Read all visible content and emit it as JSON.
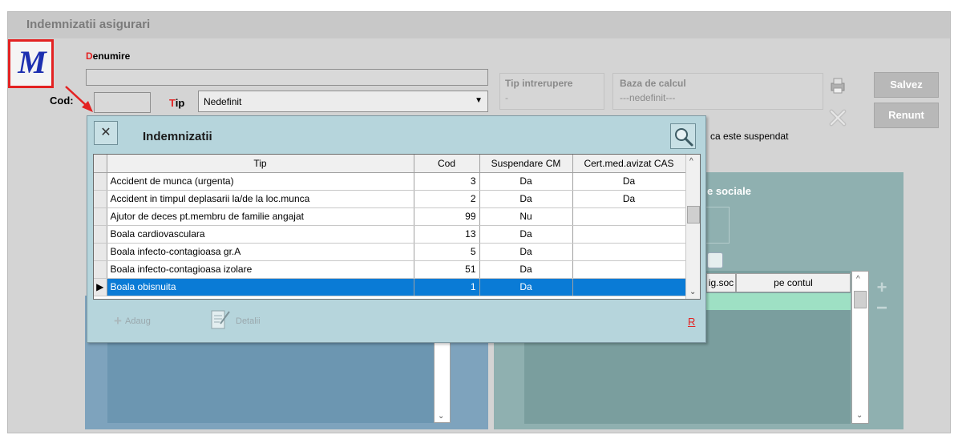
{
  "window": {
    "title": "Indemnizatii asigurari"
  },
  "form": {
    "denumire_label": "Denumire",
    "denumire_value": "",
    "cod_label": "Cod:",
    "cod_value": "",
    "tip_label": "Tip",
    "tip_value": "Nedefinit",
    "tip_intrerupere_label": "Tip intrerupere",
    "tip_intrerupere_value": "-",
    "baza_calcul_label": "Baza de calcul",
    "baza_calcul_value": "---nedefinit---",
    "suspendat_text": "ca este suspendat",
    "sociale_label": "e sociale"
  },
  "buttons": {
    "save": "Salvez",
    "cancel": "Renunt"
  },
  "right_grid": {
    "columns": [
      "ig.soc",
      "pe contul"
    ]
  },
  "dialog": {
    "title": "Indemnizatii",
    "columns": [
      "Tip",
      "Cod",
      "Suspendare CM",
      "Cert.med.avizat CAS"
    ],
    "rows": [
      {
        "tip": "Accident de munca (urgenta)",
        "cod": "3",
        "susp": "Da",
        "cert": "Da"
      },
      {
        "tip": "Accident in timpul deplasarii la/de la loc.munca",
        "cod": "2",
        "susp": "Da",
        "cert": "Da"
      },
      {
        "tip": "Ajutor de deces pt.membru de familie angajat",
        "cod": "99",
        "susp": "Nu",
        "cert": ""
      },
      {
        "tip": "Boala cardiovasculara",
        "cod": "13",
        "susp": "Da",
        "cert": ""
      },
      {
        "tip": "Boala infecto-contagioasa gr.A",
        "cod": "5",
        "susp": "Da",
        "cert": ""
      },
      {
        "tip": "Boala infecto-contagioasa izolare",
        "cod": "51",
        "susp": "Da",
        "cert": ""
      },
      {
        "tip": "Boala obisnuita",
        "cod": "1",
        "susp": "Da",
        "cert": ""
      }
    ],
    "add_label": "Adaug",
    "details_label": "Detalii",
    "r_link": "R"
  },
  "colors": {
    "accent_red": "#e32222",
    "selection_blue": "#0a7bd6",
    "dialog_bg": "#b6d5dc"
  }
}
